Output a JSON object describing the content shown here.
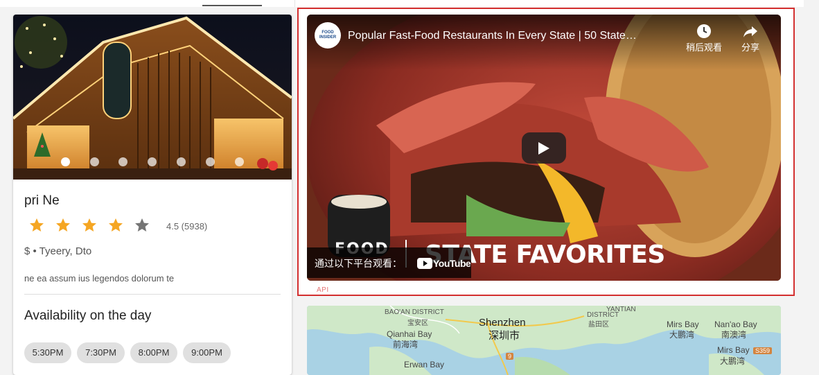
{
  "restaurant": {
    "name": "pri Ne",
    "rating_value": 4.5,
    "rating_text": "4.5 (5938)",
    "stars_filled": 4,
    "stars_total": 5,
    "meta": "$ • Tyeery, Dto",
    "description": "ne ea assum ius legendos dolorum te",
    "carousel": {
      "total": 7,
      "active": 0
    }
  },
  "availability": {
    "heading": "Availability on the day",
    "times": [
      "5:30PM",
      "7:30PM",
      "8:00PM",
      "9:00PM"
    ]
  },
  "video": {
    "channel_logo": "FOOD INSIDER",
    "title": "Popular Fast-Food Restaurants In Every State | 50 State Favor...",
    "watch_later_label": "稍后观看",
    "share_label": "分享",
    "watch_on_label": "通过以下平台观看：",
    "youtube_label": "YouTube",
    "overlay_food": "FOOD",
    "overlay_text": "STATE FAVORITES"
  },
  "api_label": "API",
  "map": {
    "labels": [
      {
        "text": "BAO'AN DISTRICT",
        "kind": "small"
      },
      {
        "text": "宝安区",
        "kind": "small"
      },
      {
        "text": "Shenzhen",
        "kind": "city"
      },
      {
        "text": "深圳市",
        "kind": "city"
      },
      {
        "text": "YANTIAN",
        "kind": "small"
      },
      {
        "text": "DISTRICT",
        "kind": "small"
      },
      {
        "text": "盐田区",
        "kind": "small"
      },
      {
        "text": "Qianhai Bay",
        "kind": "normal"
      },
      {
        "text": "前海湾",
        "kind": "normal"
      },
      {
        "text": "Mirs Bay",
        "kind": "normal"
      },
      {
        "text": "大鹏湾",
        "kind": "normal"
      },
      {
        "text": "Nan'ao Bay",
        "kind": "normal"
      },
      {
        "text": "南澳湾",
        "kind": "normal"
      },
      {
        "text": "Mirs Bay",
        "kind": "normal"
      },
      {
        "text": "大鹏湾",
        "kind": "normal"
      },
      {
        "text": "Erwan Bay",
        "kind": "normal"
      }
    ],
    "route_badges": [
      "9",
      "S359"
    ]
  },
  "colors": {
    "star": "#f5a623",
    "star_empty": "#757575",
    "highlight_border": "#d32f2f",
    "chip_bg": "#e0e0e0"
  }
}
